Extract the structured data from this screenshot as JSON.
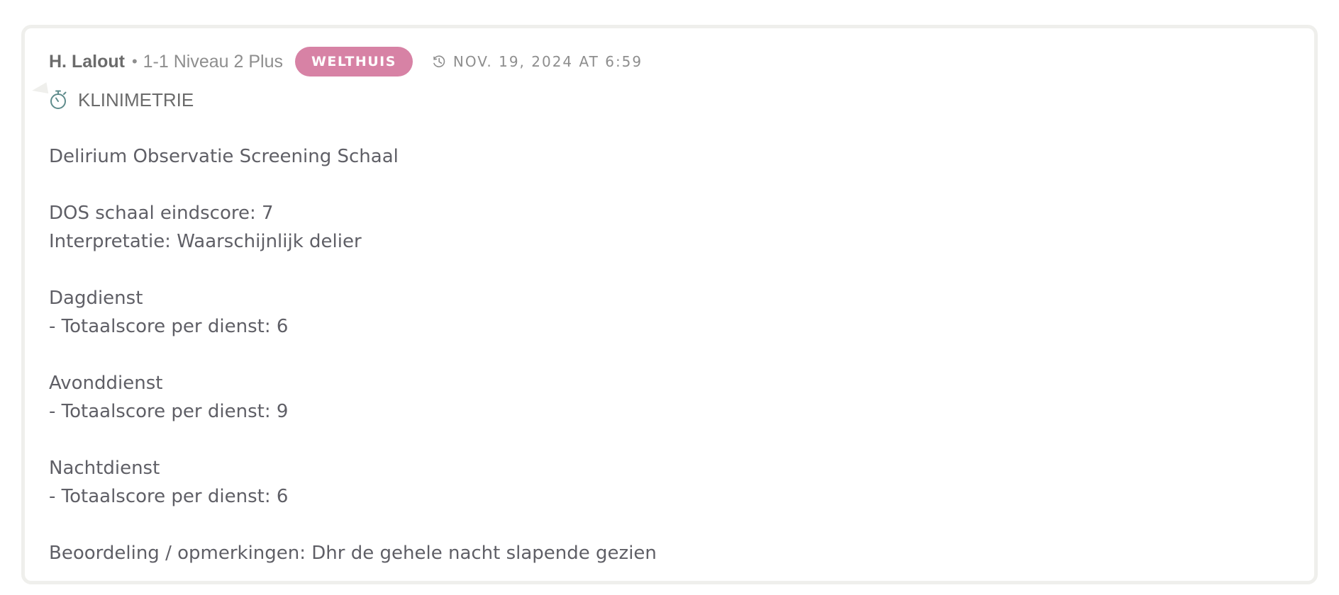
{
  "post": {
    "author": "H. Lalout",
    "separator": "•",
    "unit": "1-1 Niveau 2 Plus",
    "badge": "WELTHUIS",
    "timestamp": "NOV. 19, 2024 AT 6:59",
    "time_icon": "clock-history-icon",
    "category_icon": "stopwatch-icon",
    "category": "KLINIMETRIE",
    "colors": {
      "badge_bg": "#d782a5",
      "border": "#efefec",
      "icon": "#5f8c8c"
    },
    "content": {
      "title": "Delirium Observatie Screening Schaal",
      "final_score": "DOS schaal eindscore: 7",
      "interpretation": "Interpretatie: Waarschijnlijk delier",
      "shifts": [
        {
          "name": "Dagdienst",
          "score": "- Totaalscore per dienst: 6"
        },
        {
          "name": "Avonddienst",
          "score": "- Totaalscore per dienst: 9"
        },
        {
          "name": "Nachtdienst",
          "score": "- Totaalscore per dienst: 6"
        }
      ],
      "remarks": "Beoordeling / opmerkingen: Dhr de gehele nacht slapende gezien"
    }
  }
}
